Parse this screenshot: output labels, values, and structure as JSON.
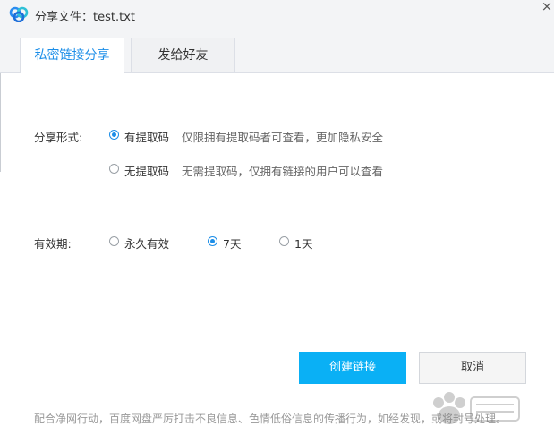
{
  "window": {
    "title": "分享文件：test.txt",
    "close_glyph": "×"
  },
  "tabs": [
    {
      "label": "私密链接分享",
      "active": true
    },
    {
      "label": "发给好友",
      "active": false
    }
  ],
  "share_form": {
    "label": "分享形式:",
    "options": [
      {
        "label": "有提取码",
        "desc": "仅限拥有提取码者可查看，更加隐私安全",
        "checked": true
      },
      {
        "label": "无提取码",
        "desc": "无需提取码，仅拥有链接的用户可以查看",
        "checked": false
      }
    ]
  },
  "validity": {
    "label": "有效期:",
    "options": [
      {
        "label": "永久有效",
        "checked": false
      },
      {
        "label": "7天",
        "checked": true
      },
      {
        "label": "1天",
        "checked": false
      }
    ]
  },
  "buttons": {
    "create": "创建链接",
    "cancel": "取消"
  },
  "footer": {
    "note": "配合净网行动，百度网盘严厉打击不良信息、色情低俗信息的传播行为，如经发现，或将封号处理。"
  },
  "colors": {
    "accent": "#1c8ee8",
    "primary_button": "#0ab0f5",
    "titlebar_bg": "#f3f4f6"
  },
  "icons": {
    "app_logo": "baidu-netdisk-cloud-icon",
    "close": "close-icon",
    "watermark": "baidu-jingyan-watermark"
  }
}
